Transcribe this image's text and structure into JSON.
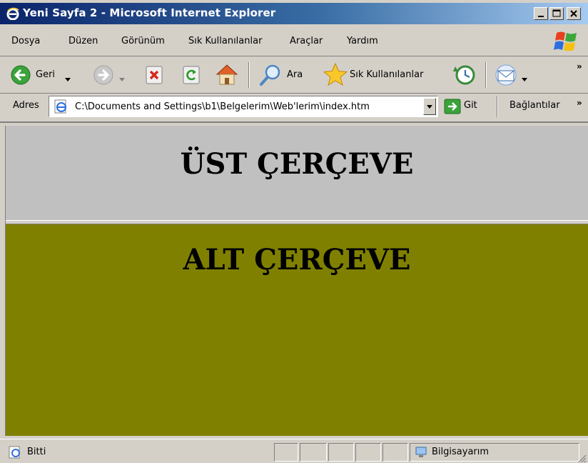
{
  "window": {
    "title": "Yeni Sayfa 2 - Microsoft Internet Explorer",
    "controls": {
      "minimize": "minimize-icon",
      "maximize": "maximize-icon",
      "close": "close-icon"
    }
  },
  "menu": {
    "items": [
      {
        "label": "Dosya"
      },
      {
        "label": "Düzen"
      },
      {
        "label": "Görünüm"
      },
      {
        "label": "Sık Kullanılanlar"
      },
      {
        "label": "Araçlar"
      },
      {
        "label": "Yardım"
      }
    ]
  },
  "toolbar": {
    "back_label": "Geri",
    "search_label": "Ara",
    "favorites_label": "Sık Kullanılanlar",
    "more": "»"
  },
  "address": {
    "label": "Adres",
    "value": "C:\\Documents and Settings\\b1\\Belgelerim\\Web'lerim\\index.htm",
    "go_label": "Git",
    "links_label": "Bağlantılar",
    "more": "»"
  },
  "frames": {
    "top": {
      "heading": "ÜST ÇERÇEVE",
      "background": "#c0c0c0"
    },
    "bottom": {
      "heading": "ALT ÇERÇEVE",
      "background": "#808000"
    }
  },
  "status": {
    "text": "Bitti",
    "zone": "Bilgisayarım"
  },
  "colors": {
    "titlebar_start": "#0a246a",
    "titlebar_end": "#a6caf0",
    "chrome": "#d4d0c8"
  }
}
